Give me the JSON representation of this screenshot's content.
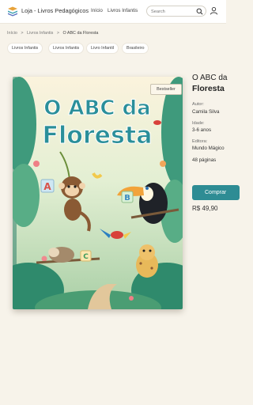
{
  "header": {
    "brand": "Loja - Livros Pedagógicos",
    "nav": [
      "Início",
      "Livros Infantis"
    ],
    "search_placeholder": "Search"
  },
  "breadcrumb": [
    "Início",
    ">",
    "Livros Infantis",
    ">",
    "O ABC da Floresta"
  ],
  "chips": [
    "Livros Infantis",
    "Livros Infantis",
    "Livro Infantil",
    "Brasileiro"
  ],
  "cover": {
    "badge": "Bestseller",
    "title_line1": "O ABC da",
    "title_line2": "Floresta",
    "letters": [
      "A",
      "B",
      "C"
    ]
  },
  "product": {
    "title_line1": "O ABC da",
    "title_line2": "Floresta",
    "author_label": "Autor:",
    "author": "Camila Silva",
    "age_label": "Idade:",
    "age": "3-6 anos",
    "publisher_label": "Editora:",
    "publisher": "Mundo Mágico",
    "pages": "48 páginas",
    "buy_label": "Comprar",
    "price": "R$ 49,90"
  },
  "colors": {
    "accent": "#2e8c94",
    "background": "#f7f3ea"
  }
}
